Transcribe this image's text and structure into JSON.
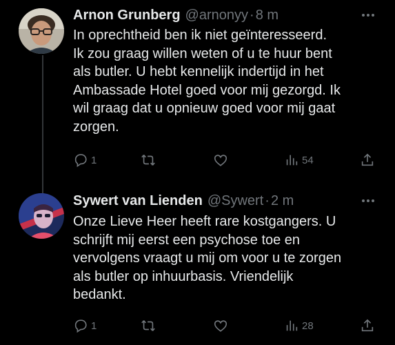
{
  "tweets": [
    {
      "name": "Arnon Grunberg",
      "handle": "@arnonyy",
      "separator": "·",
      "time": "8 m",
      "text": "In oprechtheid ben ik niet geïnteresseerd.\nIk zou graag willen weten of u te huur bent\nals butler. U hebt kennelijk indertijd in het\nAmbassade Hotel goed voor mij gezorgd. Ik\nwil graag dat u opnieuw goed voor mij gaat\nzorgen.",
      "replies": "1",
      "views": "54",
      "avatar_icon": "portrait-man-glasses"
    },
    {
      "name": "Sywert van Lienden",
      "handle": "@Sywert",
      "separator": "·",
      "time": "2 m",
      "text": "Onze Lieve Heer heeft rare kostgangers. U\nschrijft mij eerst een psychose toe en\nvervolgens vraagt u mij om voor u te zorgen\nals butler op inhuurbasis. Vriendelijk\nbedankt.",
      "replies": "1",
      "views": "28",
      "avatar_icon": "illustrated-portrait"
    }
  ],
  "colors": {
    "background": "#000000",
    "text": "#e7e9ea",
    "muted": "#71767b",
    "thread_line": "#333639"
  }
}
